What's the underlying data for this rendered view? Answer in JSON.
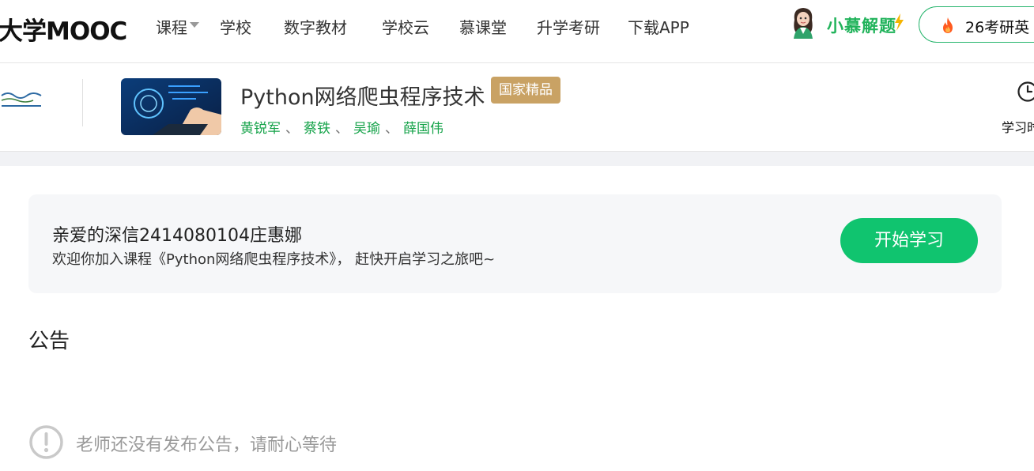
{
  "topnav": {
    "logo": "大学MOOC",
    "items": [
      {
        "label": "课程"
      },
      {
        "label": "学校"
      },
      {
        "label": "数字教材"
      },
      {
        "label": "学校云"
      },
      {
        "label": "慕课堂"
      },
      {
        "label": "升学考研"
      },
      {
        "label": "下载APP"
      }
    ],
    "mascot_label": "小慕解题",
    "promo_label": "26考研英"
  },
  "course": {
    "title": "Python网络爬虫程序技术",
    "badge": "国家精品",
    "teachers": [
      "黄锐军",
      "蔡铁",
      "吴瑜",
      "薛国伟"
    ],
    "teacher_separator": "、",
    "study_label": "学习时"
  },
  "welcome": {
    "greeting": "亲爱的深信2414080104庄惠娜",
    "message": "欢迎你加入课程《Python网络爬虫程序技术》， 赶快开启学习之旅吧~",
    "start_button": "开始学习"
  },
  "announcements": {
    "title": "公告",
    "empty_text": "老师还没有发布公告，请耐心等待"
  },
  "colors": {
    "accent_green": "#10c46f",
    "teacher_green": "#16a34a",
    "badge_gold": "#c9a264"
  },
  "icons": [
    "caret-down-icon",
    "avatar-icon",
    "bolt-icon",
    "fire-icon",
    "clock-icon",
    "exclamation-circle-icon"
  ]
}
